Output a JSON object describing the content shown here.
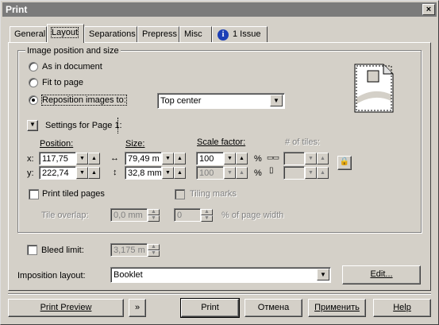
{
  "window": {
    "title": "Print",
    "close_glyph": "×"
  },
  "tabs": [
    {
      "label": "General"
    },
    {
      "label": "Layout"
    },
    {
      "label": "Separations"
    },
    {
      "label": "Prepress"
    },
    {
      "label": "Misc"
    },
    {
      "label": "1 Issue"
    }
  ],
  "issue_icon_glyph": "i",
  "image_position": {
    "group_label": "Image position and size",
    "options": [
      "As in document",
      "Fit to page",
      "Reposition images to:"
    ],
    "selected": "Reposition images to:",
    "reposition_value": "Top center"
  },
  "settings": {
    "label": "Settings for Page 1:",
    "position_label": "Position:",
    "size_label": "Size:",
    "scale_label": "Scale factor:",
    "tiles_label": "# of tiles:",
    "x_label": "x:",
    "y_label": "y:",
    "x_value": "117,75",
    "y_value": "222,74",
    "width_value": "79,49 m",
    "height_value": "32,8 mm",
    "scale_x": "100",
    "scale_y": "100",
    "percent": "%",
    "tiles_x": "",
    "tiles_y": ""
  },
  "tiling": {
    "print_tiled_label": "Print tiled pages",
    "tiling_marks_label": "Tiling marks",
    "tile_overlap_label": "Tile overlap:",
    "tile_overlap_value": "0,0 mm",
    "page_width_value": "0",
    "page_width_label": "% of page width"
  },
  "bleed": {
    "label": "Bleed limit:",
    "value": "3,175 m"
  },
  "imposition": {
    "label": "Imposition layout:",
    "value": "Booklet",
    "edit_label": "Edit..."
  },
  "footer": {
    "print_preview": "Print Preview",
    "expand_glyph": "»",
    "print": "Print",
    "cancel": "Отмена",
    "apply": "Применить",
    "help": "Help"
  }
}
